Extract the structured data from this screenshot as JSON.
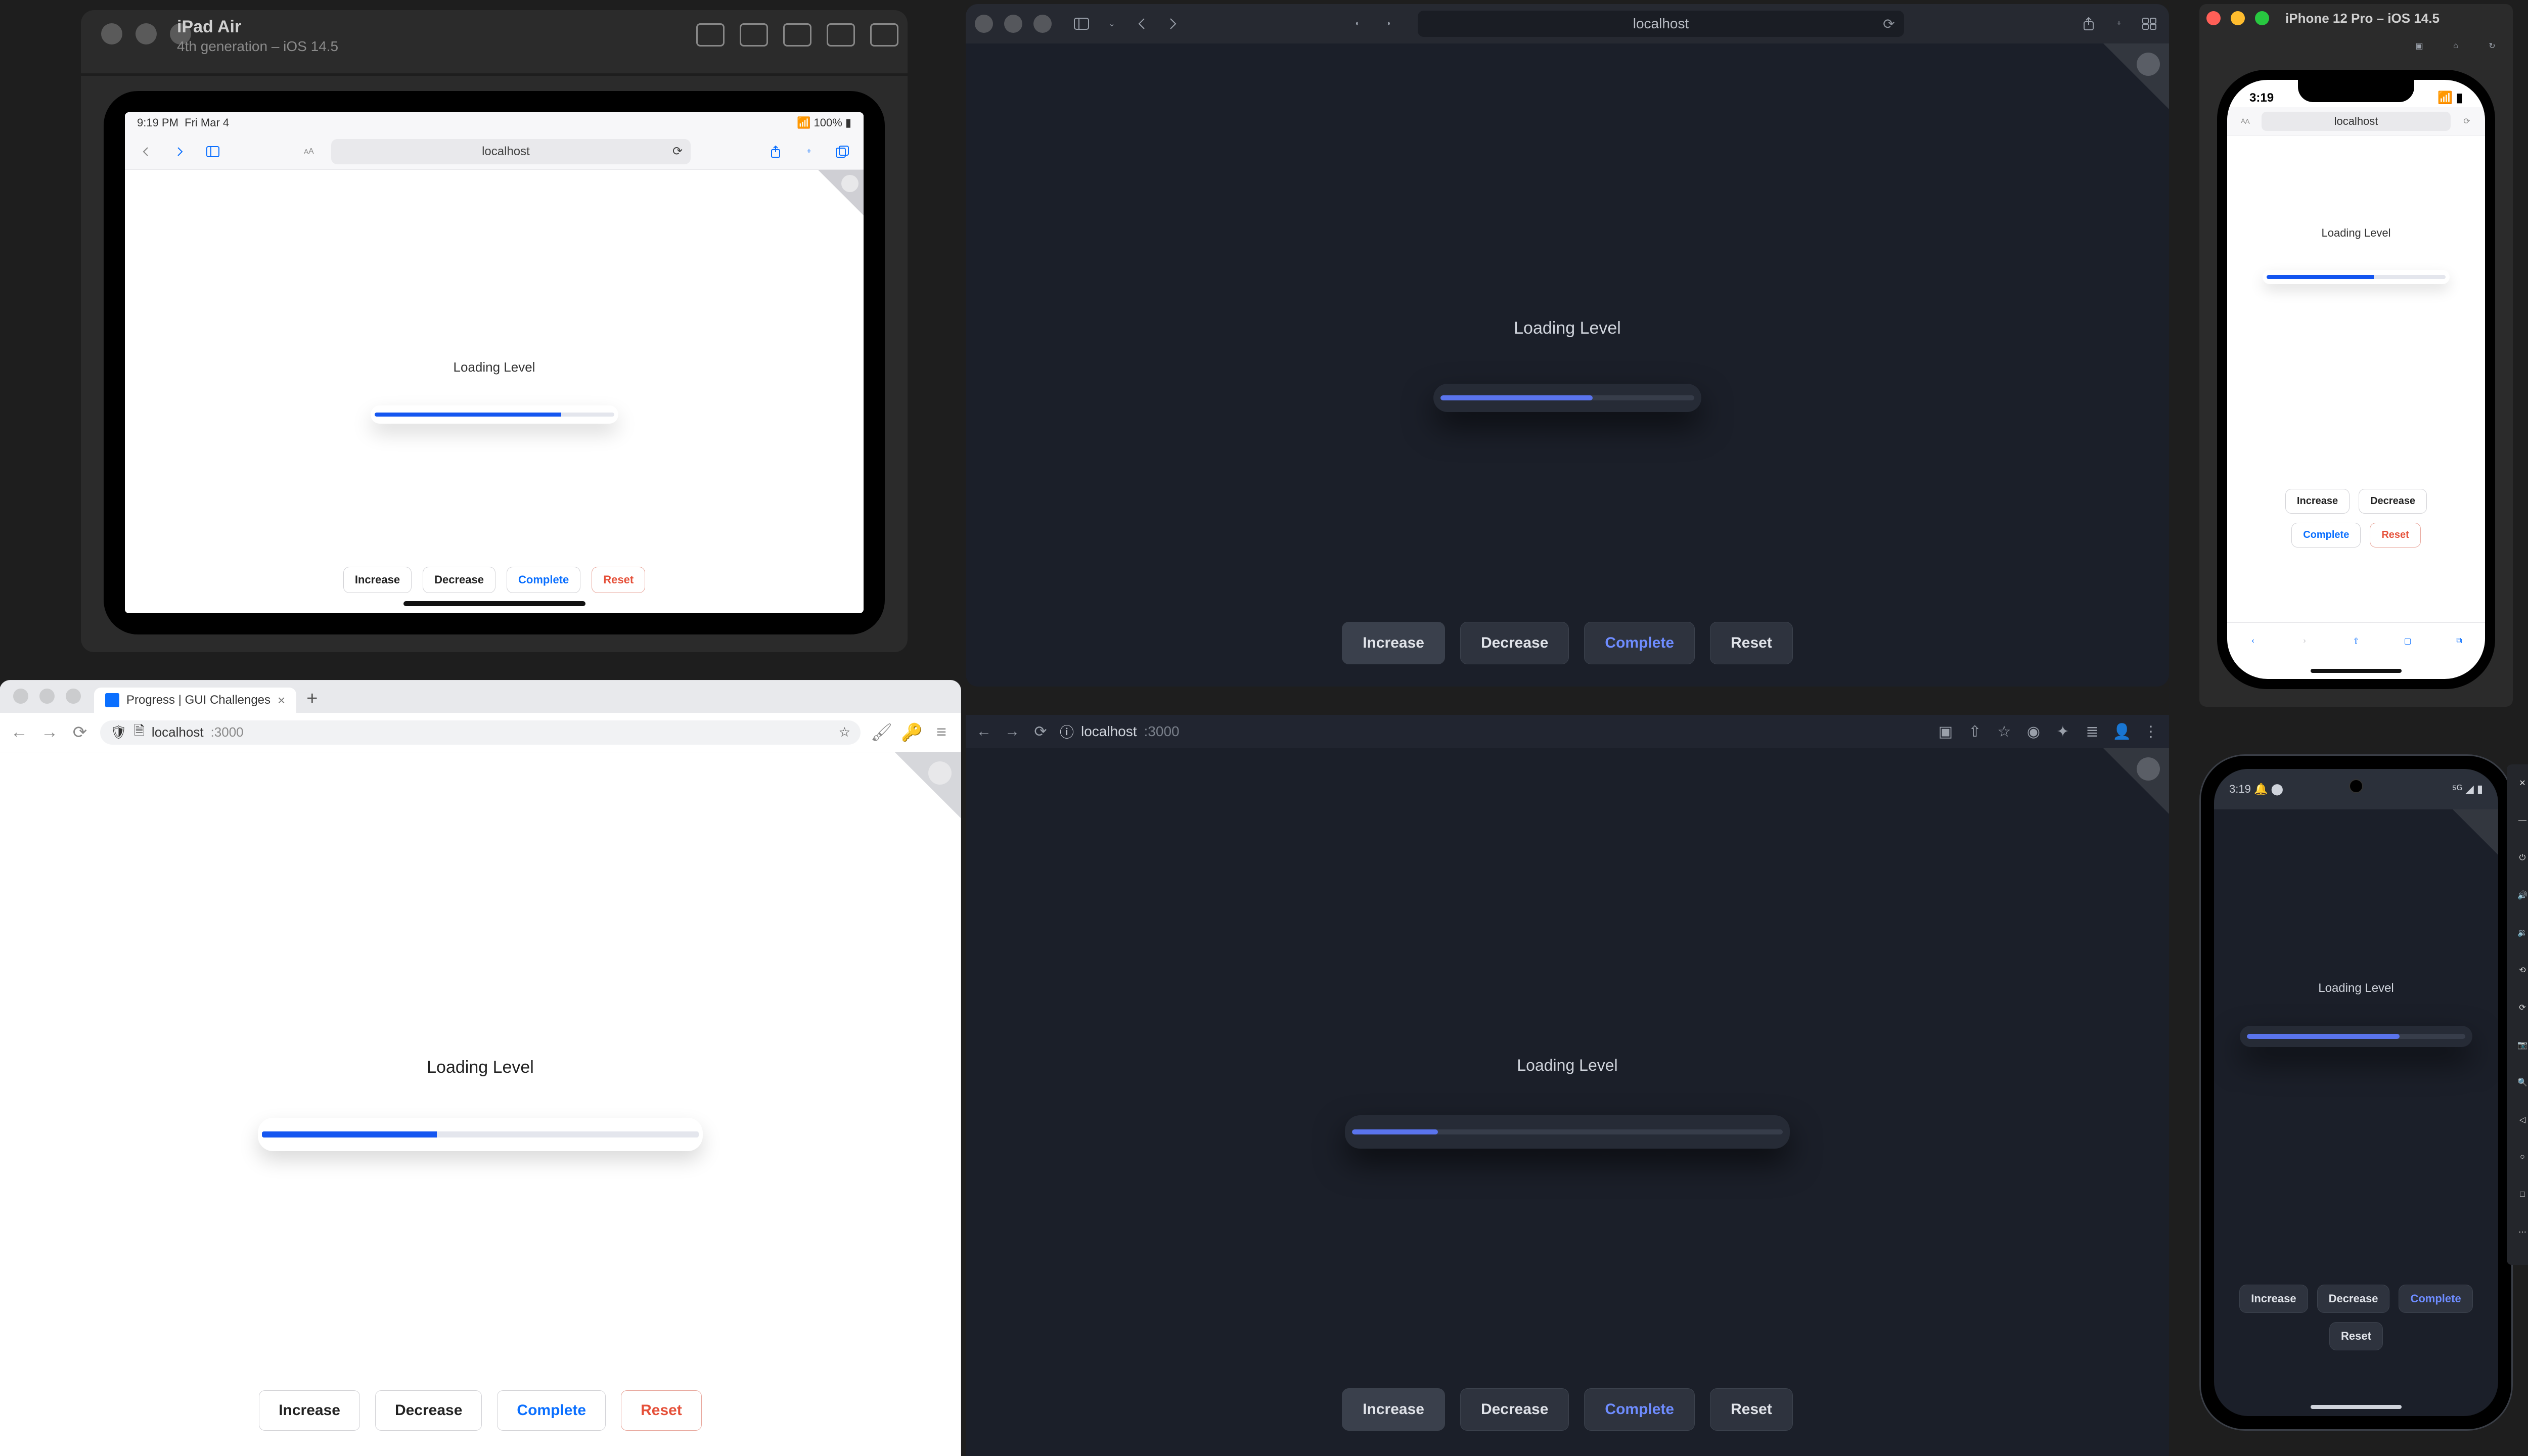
{
  "app_common": {
    "loading_label": "Loading Level",
    "buttons": {
      "increase": "Increase",
      "decrease": "Decrease",
      "complete": "Complete",
      "reset": "Reset"
    }
  },
  "ipad": {
    "window_title": "iPad Air",
    "window_subtitle": "4th generation – iOS 14.5",
    "status_time": "9:19 PM",
    "status_date": "Fri Mar 4",
    "status_battery": "100%",
    "url": "localhost",
    "progress_pct": 78
  },
  "safari_dark": {
    "url": "localhost",
    "progress_pct": 60
  },
  "iphone": {
    "window_title": "iPhone 12 Pro – iOS 14.5",
    "status_time": "3:19",
    "url": "localhost",
    "progress_pct": 60
  },
  "chrome_light": {
    "tab_title": "Progress | GUI Challenges",
    "host": "localhost",
    "port": ":3000",
    "progress_pct": 40
  },
  "chrome_dark": {
    "host": "localhost",
    "port": ":3000",
    "progress_pct": 20
  },
  "android": {
    "status_time": "3:19",
    "progress_pct": 70
  }
}
